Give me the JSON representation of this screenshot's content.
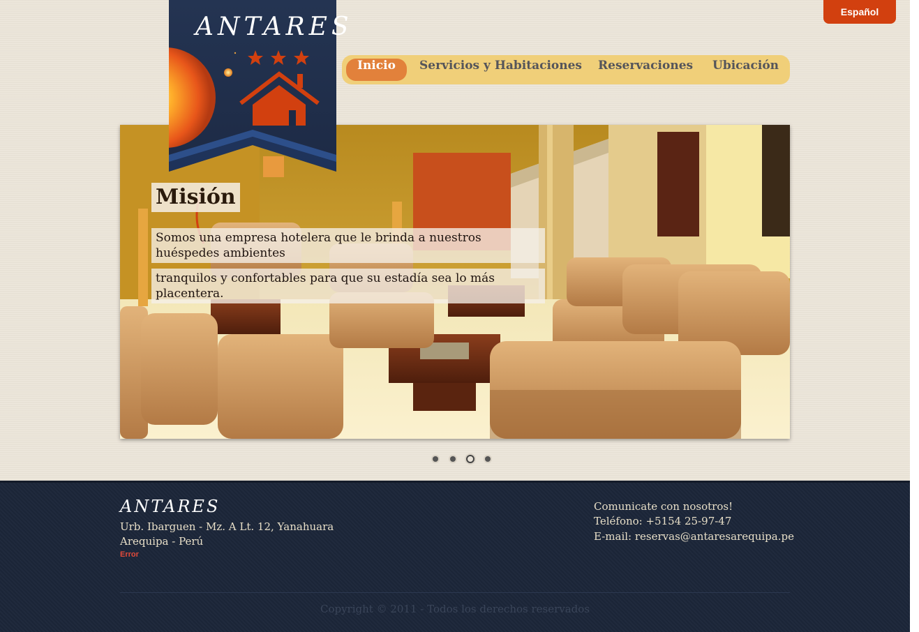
{
  "header": {
    "language_button": "Español",
    "logo_text": "ANTARES"
  },
  "nav": {
    "items": [
      {
        "label": "Inicio",
        "active": true
      },
      {
        "label": "Servicios y Habitaciones",
        "active": false
      },
      {
        "label": "Reservaciones",
        "active": false
      },
      {
        "label": "Ubicación",
        "active": false
      }
    ]
  },
  "slider": {
    "title": "Misión",
    "lines": [
      "Somos una empresa hotelera que le brinda a nuestros huéspedes ambientes",
      "tranquilos y confortables para que su estadía sea lo más placentera."
    ],
    "dots_count": 4,
    "active_dot": 3
  },
  "footer": {
    "brand": "ANTARES",
    "address_line1": "Urb. Ibarguen - Mz. A Lt. 12, Yanahuara",
    "address_line2": "Arequipa - Perú",
    "error_text": "Error",
    "contact_heading": "Comunicate con nosotros!",
    "phone": "Teléfono: +5154 25-97-47",
    "email": "E-mail: reservas@antaresarequipa.pe",
    "copyright": "Copyright © 2011 - Todos los derechos reservados"
  },
  "colors": {
    "accent": "#d2400f",
    "nav_bg": "#f0cf79",
    "nav_active": "#e2813b",
    "footer_bg": "#1c2639"
  }
}
